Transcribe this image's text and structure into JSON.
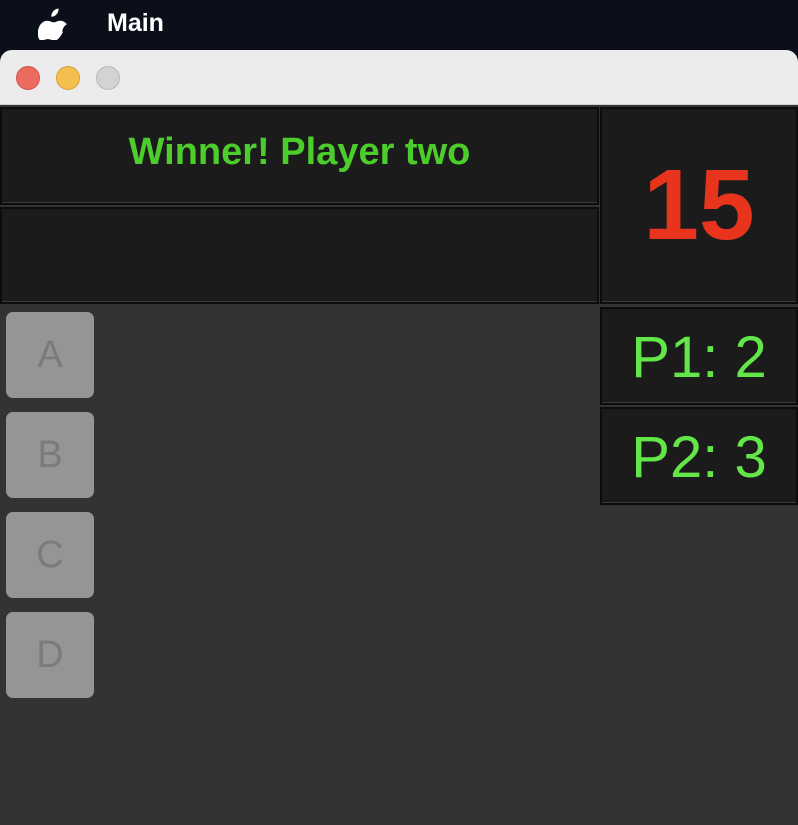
{
  "menubar": {
    "app_name": "Main",
    "icon": "apple-icon"
  },
  "window": {
    "buttons": {
      "close": "close-button",
      "minimize": "minimize-button",
      "zoom": "zoom-button"
    }
  },
  "game": {
    "status": "Winner! Player two",
    "message": "",
    "timer": "15",
    "scores": {
      "p1": "P1: 2",
      "p2": "P2: 3"
    },
    "answers": [
      "A",
      "B",
      "C",
      "D"
    ]
  },
  "colors": {
    "status_text": "#4ccd2c",
    "timer_text": "#e8341c",
    "score_text": "#63e647",
    "panel_bg": "#1b1b1b",
    "window_bg": "#333333",
    "button_bg": "#959595"
  }
}
